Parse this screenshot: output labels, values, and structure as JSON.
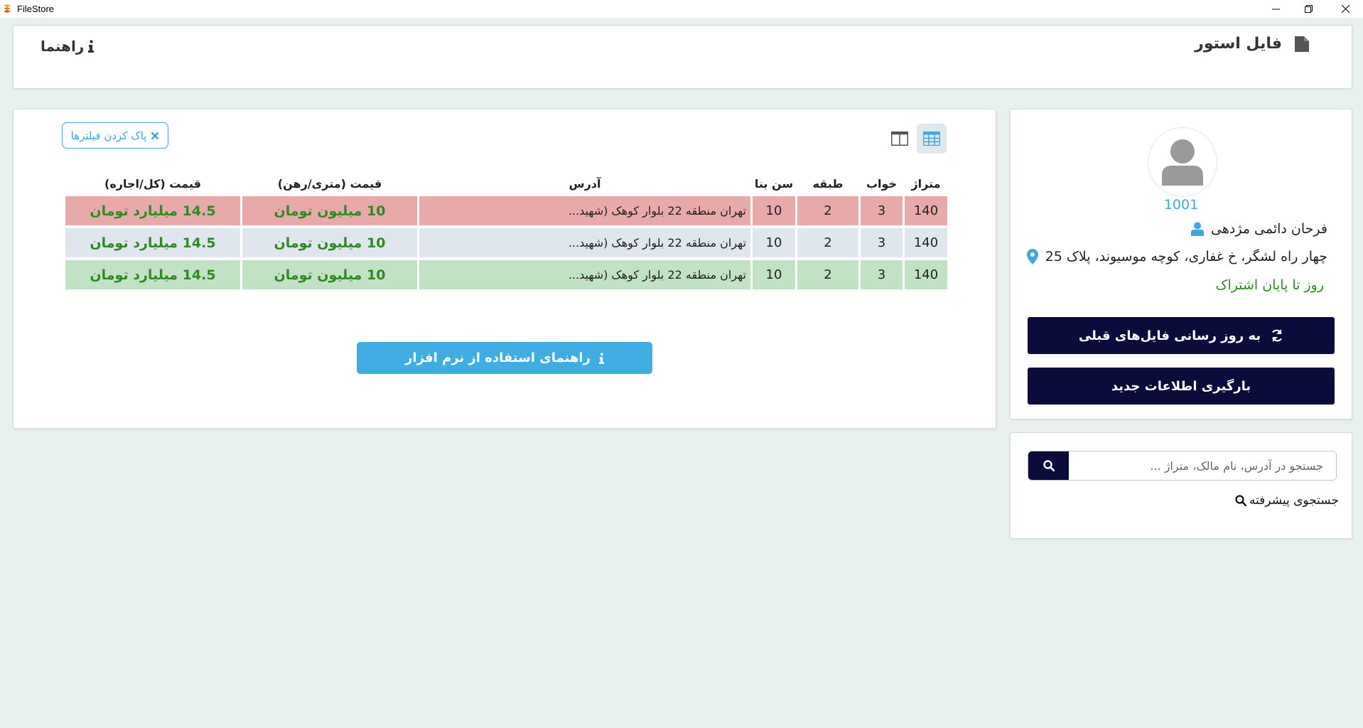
{
  "window": {
    "title": "FileStore"
  },
  "header": {
    "brand_title": "فایل استور",
    "guide_label": "راهنما"
  },
  "toolbar": {
    "clear_filters_label": "پاک کردن فیلترها"
  },
  "table": {
    "columns": [
      "متراژ",
      "خواب",
      "طبقه",
      "سن بنا",
      "آدرس",
      "قیمت (متری/رهن)",
      "قیمت (کل/اجاره)"
    ],
    "rows": [
      {
        "status": "red",
        "area": "140",
        "beds": "3",
        "floor": "2",
        "age": "10",
        "address": "تهران منطقه 22 بلوار کوهک (شهید...",
        "price_mortgage": "10 میلیون تومان",
        "price_rent": "14.5 میلیارد تومان"
      },
      {
        "status": "gray",
        "area": "140",
        "beds": "3",
        "floor": "2",
        "age": "10",
        "address": "تهران منطقه 22 بلوار کوهک (شهید...",
        "price_mortgage": "10 میلیون تومان",
        "price_rent": "14.5 میلیارد تومان"
      },
      {
        "status": "green",
        "area": "140",
        "beds": "3",
        "floor": "2",
        "age": "10",
        "address": "تهران منطقه 22 بلوار کوهک (شهید...",
        "price_mortgage": "10 میلیون تومان",
        "price_rent": "14.5 میلیارد تومان"
      }
    ]
  },
  "help_button_label": "راهنمای استفاده از نرم افزار",
  "profile": {
    "user_id": "1001",
    "name": "فرحان دائمی مژدهی",
    "address": "چهار راه لشگر، خ غفاری، کوچه موسیوند، پلاک 25",
    "subscription_text": "روز تا پایان اشتراک",
    "update_files_label": "به روز رسانی فایل‌های قبلی",
    "load_new_label": "بارگیری اطلاعات جدید"
  },
  "search": {
    "placeholder": "جستجو در آدرس، نام مالک، متراژ ...",
    "advanced_label": "جستجوی پیشرفته"
  },
  "colors": {
    "accent_blue": "#3ea7de",
    "dark_navy": "#0b0c3b",
    "price_green": "#2e8b22",
    "row_red": "#e8a9a9",
    "row_gray": "#dfe6ee",
    "row_green": "#bfe3c3",
    "background": "#e8f0ef"
  }
}
